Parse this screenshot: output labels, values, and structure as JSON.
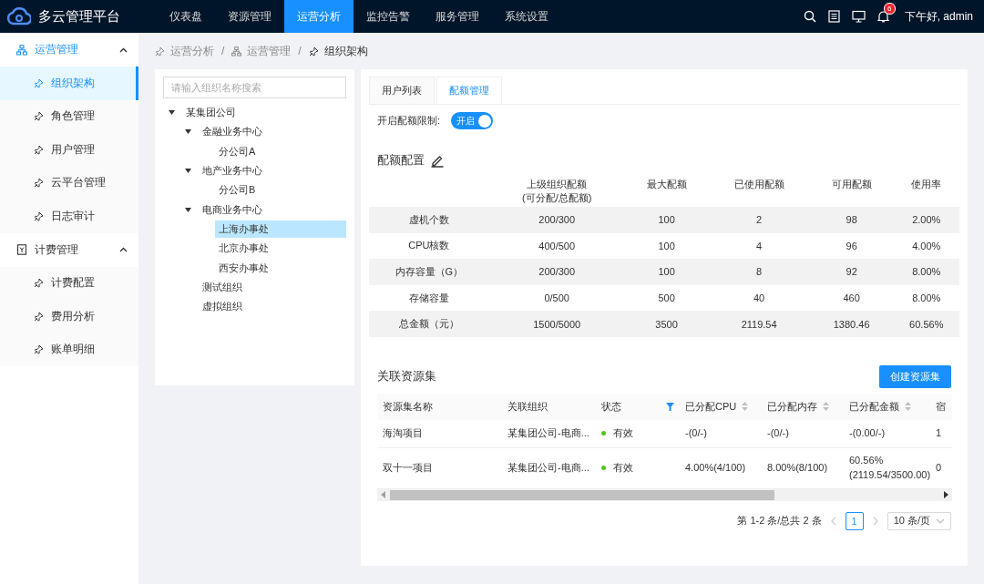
{
  "header": {
    "title": "多云管理平台",
    "nav": [
      {
        "label": "仪表盘",
        "selected": false
      },
      {
        "label": "资源管理",
        "selected": false
      },
      {
        "label": "运营分析",
        "selected": true
      },
      {
        "label": "监控告警",
        "selected": false
      },
      {
        "label": "服务管理",
        "selected": false
      },
      {
        "label": "系统设置",
        "selected": false
      }
    ],
    "notification_count": "6",
    "greeting": "下午好, admin"
  },
  "sidebar": {
    "groups": [
      {
        "label": "运营管理",
        "kind": "org",
        "expanded": true,
        "selected": true,
        "items": [
          {
            "label": "组织架构",
            "selected": true
          },
          {
            "label": "角色管理",
            "selected": false
          },
          {
            "label": "用户管理",
            "selected": false
          },
          {
            "label": "云平台管理",
            "selected": false
          },
          {
            "label": "日志审计",
            "selected": false
          }
        ]
      },
      {
        "label": "计费管理",
        "kind": "bill",
        "expanded": true,
        "selected": false,
        "items": [
          {
            "label": "计费配置",
            "selected": false
          },
          {
            "label": "费用分析",
            "selected": false
          },
          {
            "label": "账单明细",
            "selected": false
          }
        ]
      }
    ]
  },
  "breadcrumb": [
    {
      "label": "运营分析",
      "kind": "pin"
    },
    {
      "separator": "/",
      "label": "运营管理",
      "kind": "org"
    },
    {
      "separator": "/",
      "label": "组织架构",
      "kind": "pin"
    }
  ],
  "tree": {
    "search": {
      "placeholder": "请输入组织名称搜索"
    },
    "nodes": [
      {
        "label": "某集团公司",
        "expanded": true,
        "selected": false,
        "children": [
          {
            "label": "金融业务中心",
            "expanded": true,
            "selected": false,
            "children": [
              {
                "label": "分公司A",
                "selected": false
              }
            ]
          },
          {
            "label": "地产业务中心",
            "expanded": true,
            "selected": false,
            "children": [
              {
                "label": "分公司B",
                "selected": false
              }
            ]
          },
          {
            "label": "电商业务中心",
            "expanded": true,
            "selected": false,
            "children": [
              {
                "label": "上海办事处",
                "selected": true
              },
              {
                "label": "北京办事处",
                "selected": false
              },
              {
                "label": "西安办事处",
                "selected": false
              }
            ]
          },
          {
            "label": "测试组织",
            "selected": false
          },
          {
            "label": "虚拟组织",
            "selected": false
          }
        ]
      }
    ]
  },
  "tabs": [
    {
      "label": "用户列表",
      "selected": false
    },
    {
      "label": "配额管理",
      "selected": true
    }
  ],
  "quota_limit": {
    "label": "开启配额限制:",
    "on": true,
    "switch_text": "开启"
  },
  "quota": {
    "title": "配额配置",
    "columns": [
      "",
      "上级组织配额\n(可分配/总配额)",
      "最大配额",
      "已使用配额",
      "可用配额",
      "使用率"
    ],
    "rows": [
      [
        "虚机个数",
        "200/300",
        "100",
        "2",
        "98",
        "2.00%"
      ],
      [
        "CPU核数",
        "400/500",
        "100",
        "4",
        "96",
        "4.00%"
      ],
      [
        "内存容量（G）",
        "200/300",
        "100",
        "8",
        "92",
        "8.00%"
      ],
      [
        "存储容量",
        "0/500",
        "500",
        "40",
        "460",
        "8.00%"
      ],
      [
        "总金额（元）",
        "1500/5000",
        "3500",
        "2119.54",
        "1380.46",
        "60.56%"
      ]
    ]
  },
  "resource_sets": {
    "title": "关联资源集",
    "create_button": "创建资源集",
    "columns": [
      {
        "label": "资源集名称",
        "kind": "plain"
      },
      {
        "label": "关联组织",
        "kind": "plain"
      },
      {
        "label": "状态",
        "kind": "filter"
      },
      {
        "label": "已分配CPU",
        "kind": "sort"
      },
      {
        "label": "已分配内存",
        "kind": "sort"
      },
      {
        "label": "已分配金额",
        "kind": "sort"
      },
      {
        "label": "宿",
        "kind": "plain"
      }
    ],
    "rows": [
      {
        "name": "海淘项目",
        "org": "某集团公司-电商...",
        "status": "有效",
        "color": "#52c41a",
        "cpu": "-(0/-)",
        "memory": "-(0/-)",
        "amount": "-(0.00/-)",
        "column_7": "1"
      },
      {
        "name": "双十一项目",
        "org": "某集团公司-电商...",
        "status": "有效",
        "color": "#52c41a",
        "cpu": "4.00%(4/100)",
        "memory": "8.00%(8/100)",
        "amount": "60.56%\n(2119.54/3500.00)",
        "column_7": "0"
      }
    ]
  },
  "pagination": {
    "summary": "第 1-2 条/总共 2 条",
    "pages": [
      {
        "label": "1",
        "selected": true
      }
    ],
    "page_size": "10 条/页"
  }
}
